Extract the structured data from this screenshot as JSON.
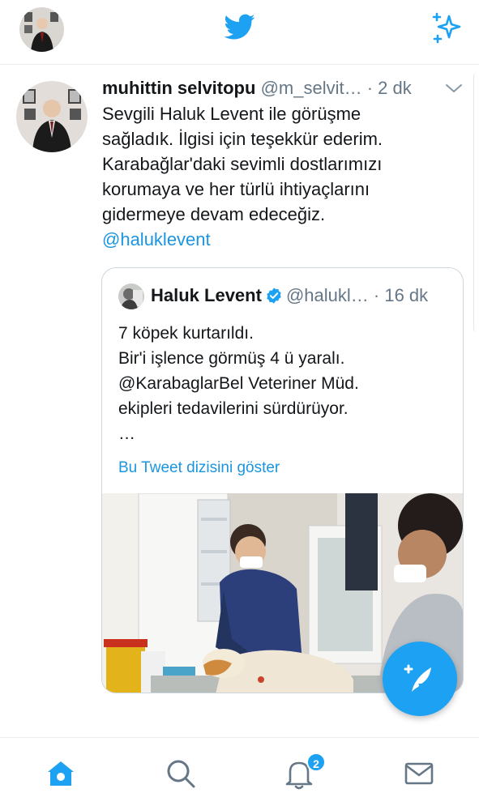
{
  "header": {
    "avatar_icon": "profile-avatar-icon",
    "logo_icon": "twitter-bird-icon",
    "sparkle_icon": "sparkle-icon"
  },
  "tweet": {
    "author_name": "muhittin selvitopu",
    "handle": "@m_selvit…",
    "time": "· 2 dk",
    "body_lines": [
      "Sevgili Haluk Levent ile görüşme",
      "sağladık. İlgisi için teşekkür ederim.",
      "Karabağlar'daki sevimli dostlarımızı",
      "korumaya ve her türlü ihtiyaçlarını",
      "gidermeye devam edeceğiz."
    ],
    "mention": "@haluklevent",
    "quote": {
      "author_name": "Haluk Levent",
      "handle": "@halukl…",
      "time": "· 16 dk",
      "body_lines": [
        "7 köpek kurtarıldı.",
        "Bir'i işlence görmüş 4 ü yaralı.",
        "@KarabaglarBel Veteriner Müd.",
        "ekipleri tedavilerini sürdürüyor.",
        "…"
      ],
      "show_thread": "Bu Tweet dizisini göster"
    }
  },
  "bottom_nav": {
    "notifications_badge": "2"
  },
  "colors": {
    "accent": "#1da1f2",
    "link": "#1b95e0",
    "secondary_text": "#657786"
  }
}
